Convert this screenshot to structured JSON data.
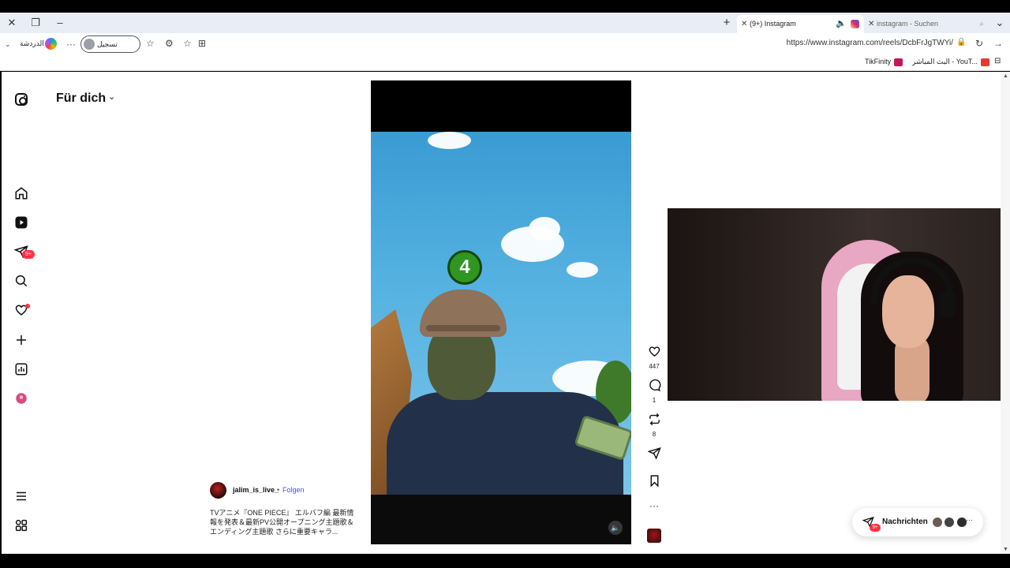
{
  "browser": {
    "window_controls": {
      "close": "✕",
      "restore": "❐",
      "minimize": "–"
    },
    "new_tab": "+",
    "tabs": [
      {
        "label": "(9+) Instagram",
        "active": true
      },
      {
        "label": "instagram - Suchen",
        "active": false
      }
    ],
    "address": {
      "url": "https://www.instagram.com/reels/DcbFrJgTWYi/",
      "login_label": "تسجيل الدخول",
      "chat_label": "الدردشة",
      "more": "···"
    },
    "bookmarks": [
      {
        "label": "TikFinity",
        "color": "#c2185b"
      },
      {
        "label": "البث المباشر - YouT...",
        "color": "#e53935"
      }
    ]
  },
  "instagram": {
    "feed_title": "Für dich",
    "nav": [
      {
        "name": "home-icon"
      },
      {
        "name": "reels-icon"
      },
      {
        "name": "messages-icon",
        "badge": "9+"
      },
      {
        "name": "search-icon"
      },
      {
        "name": "notifications-icon",
        "dot": true
      },
      {
        "name": "create-icon"
      },
      {
        "name": "insights-icon"
      },
      {
        "name": "profile-icon"
      },
      {
        "name": "menu-icon"
      },
      {
        "name": "more-apps-icon"
      }
    ],
    "reel": {
      "overlay_number": "4",
      "likes": "447",
      "comments": "1",
      "reposts": "8",
      "author": "jalim_is_live_",
      "separator": "•",
      "follow_label": "Folgen",
      "caption": "TVアニメ『ONE PIECE』 エルバフ編 最新情報を発表＆最新PV公開オープニング主題歌＆エンディング主題歌 さらに重要キャラ..."
    },
    "messages": {
      "label": "Nachrichten",
      "badge": "9+",
      "more": "···"
    }
  },
  "colors": {
    "accent_blue": "#4150f7",
    "notification_red": "#ff3040",
    "tab_bar": "#e9eef6"
  }
}
